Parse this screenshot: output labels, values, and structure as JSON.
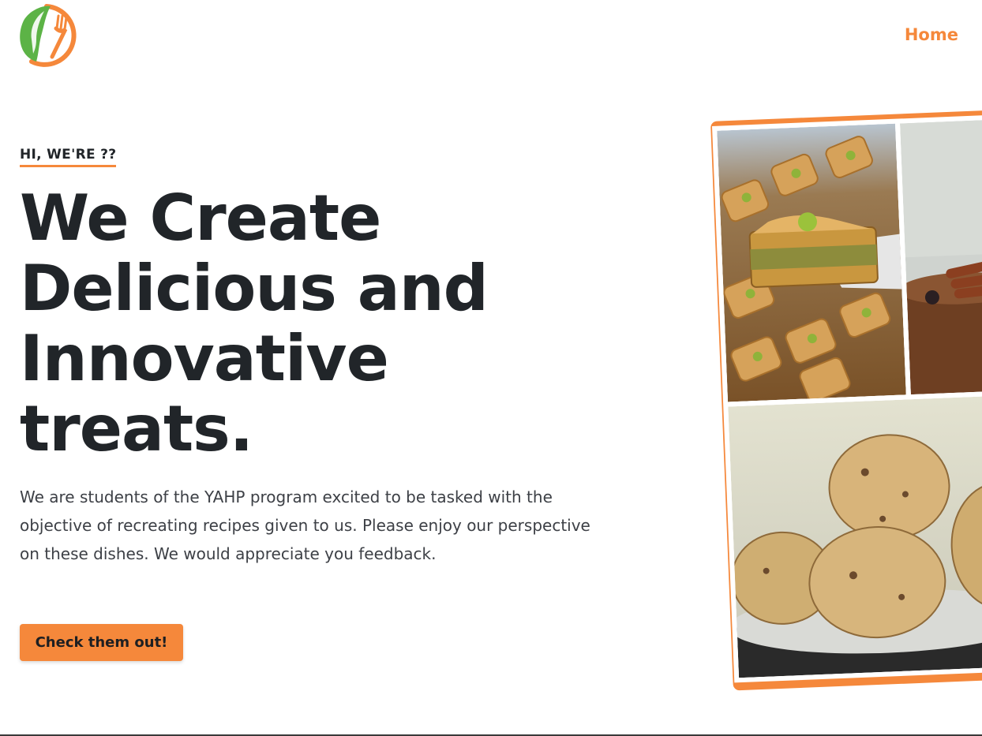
{
  "nav": {
    "home_label": "Home"
  },
  "hero": {
    "eyebrow": "HI, WE'RE ??",
    "headline_lines": [
      "We Create",
      "Delicious and",
      "Innovative",
      "treats."
    ],
    "description": "We are students of the YAHP program excited to be tasked with the objective of recreating recipes given to us. Please enjoy our perspective on these dishes. We would appreciate you feedback.",
    "cta_label": "Check them out!"
  },
  "colors": {
    "accent": "#f5883b",
    "logo_green": "#5cb346",
    "text_dark": "#212529"
  },
  "icons": {
    "logo": "leaf-fork-logo-icon"
  }
}
